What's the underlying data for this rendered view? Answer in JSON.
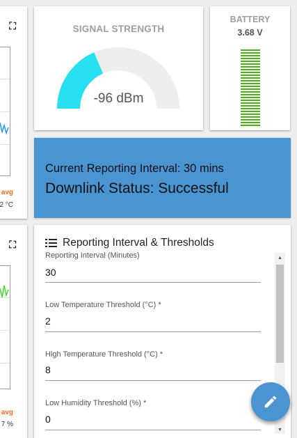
{
  "left_cards": [
    {
      "avg_label": "avg",
      "unit_label": "2 °C"
    },
    {
      "avg_label": "avg",
      "unit_label": "7 %"
    }
  ],
  "signal": {
    "title": "SIGNAL STRENGTH",
    "value": "-96 dBm",
    "level": 0.37,
    "colors": {
      "fill": "#26e0f2",
      "track": "#eeeeee"
    }
  },
  "battery": {
    "label": "BATTERY",
    "voltage": "3.68 V",
    "segments_lit": 28,
    "color": "#4caf1a"
  },
  "status_panel": {
    "reporting_interval": "Current Reporting Interval: 30 mins",
    "downlink_status": "Downlink Status: Successful",
    "color": "#4a94d2"
  },
  "settings_form": {
    "title": "Reporting Interval & Thresholds",
    "icon": "list-icon",
    "fields": [
      {
        "label": "Reporting Interval (Minutes)",
        "value": "30"
      },
      {
        "label": "Low Temperature Threshold (°C) *",
        "value": "2"
      },
      {
        "label": "High Temperature Threshold (°C) *",
        "value": "8"
      },
      {
        "label": "Low Humidity Threshold (%) *",
        "value": "0"
      }
    ]
  },
  "fab": {
    "icon": "edit-pencil-icon",
    "color": "#4a94d2"
  }
}
